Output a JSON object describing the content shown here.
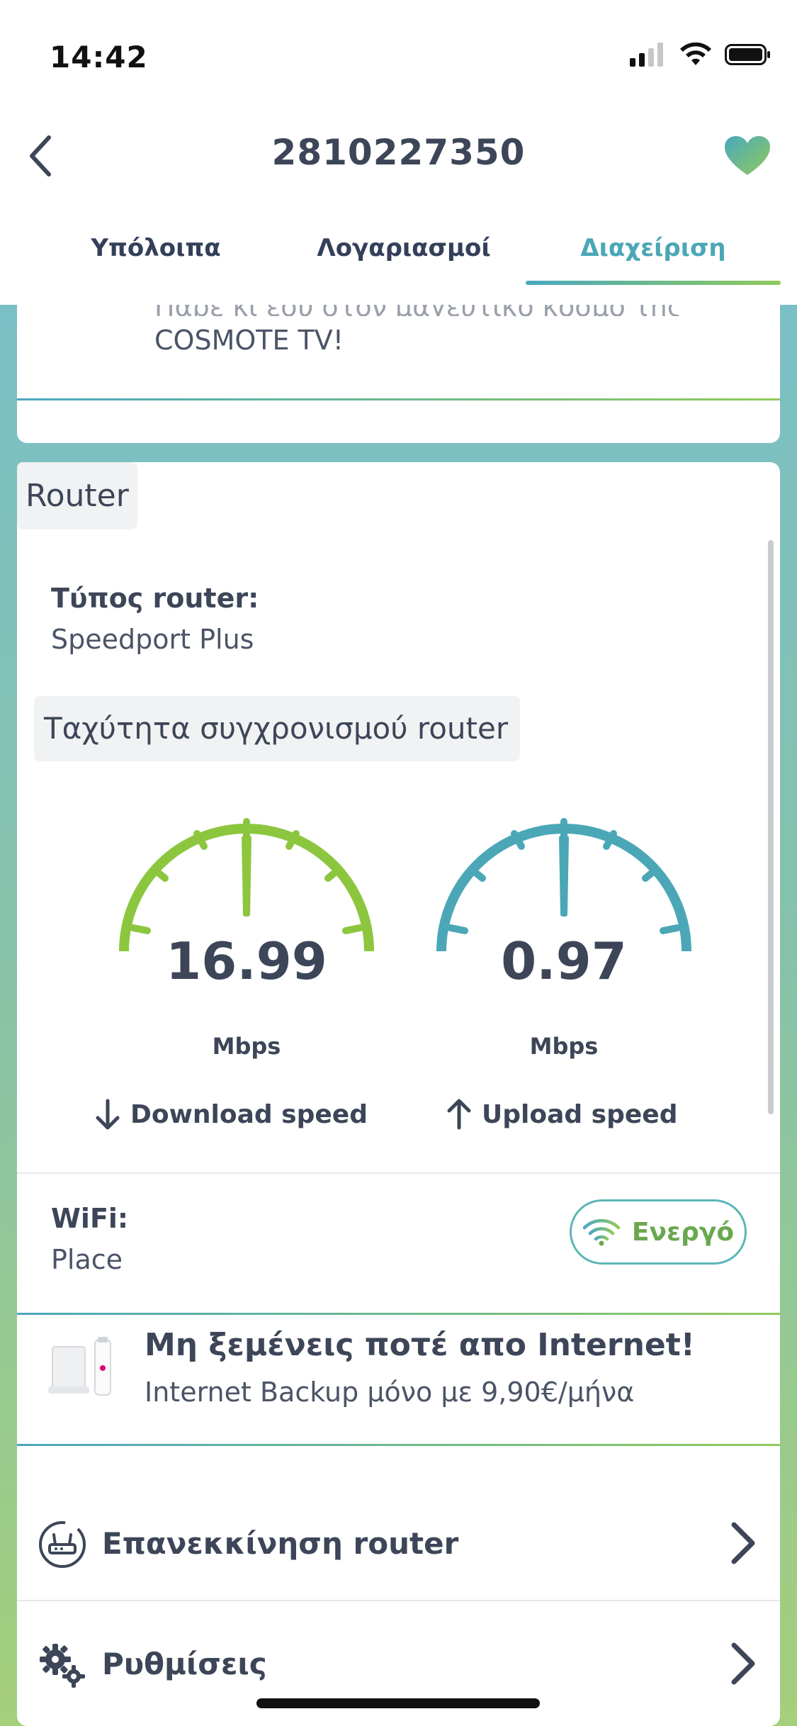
{
  "status_bar": {
    "time": "14:42",
    "icons": [
      "signal-icon",
      "wifi-icon",
      "battery-icon"
    ]
  },
  "header": {
    "title": "2810227350",
    "back_icon": "chevron-left-icon",
    "favorite_icon": "heart-icon"
  },
  "tabs": [
    {
      "label": "Υπόλοιπα",
      "active": false
    },
    {
      "label": "Λογαριασμοί",
      "active": false
    },
    {
      "label": "Διαχείριση",
      "active": true
    }
  ],
  "promo": {
    "line1_faded": "Πάρε κι εσύ στον μαγευτικό κόσμο της",
    "line2": "COSMOTE TV!"
  },
  "router": {
    "section_title": "Router",
    "type_label": "Τύπος router:",
    "type_value": "Speedport Plus",
    "sync_title": "Ταχύτητα συγχρονισμού router",
    "download": {
      "value": "16.99",
      "unit": "Mbps",
      "label": "Download speed",
      "color": "#8cc63f"
    },
    "upload": {
      "value": "0.97",
      "unit": "Mbps",
      "label": "Upload speed",
      "color": "#4ba7b6"
    }
  },
  "wifi": {
    "label": "WiFi:",
    "value": "Place",
    "status": "Ενεργό"
  },
  "backup": {
    "title": "Μη ξεμένεις ποτέ απο Internet!",
    "subtitle": "Internet Backup μόνο με 9,90€/μήνα"
  },
  "menu": [
    {
      "label": "Επανεκκίνηση router",
      "icon": "router-restart-icon"
    },
    {
      "label": "Ρυθμίσεις",
      "icon": "gears-icon"
    }
  ],
  "colors": {
    "accent_teal": "#4ba7b6",
    "accent_green": "#8cc63f",
    "text_dark": "#3d4658"
  }
}
